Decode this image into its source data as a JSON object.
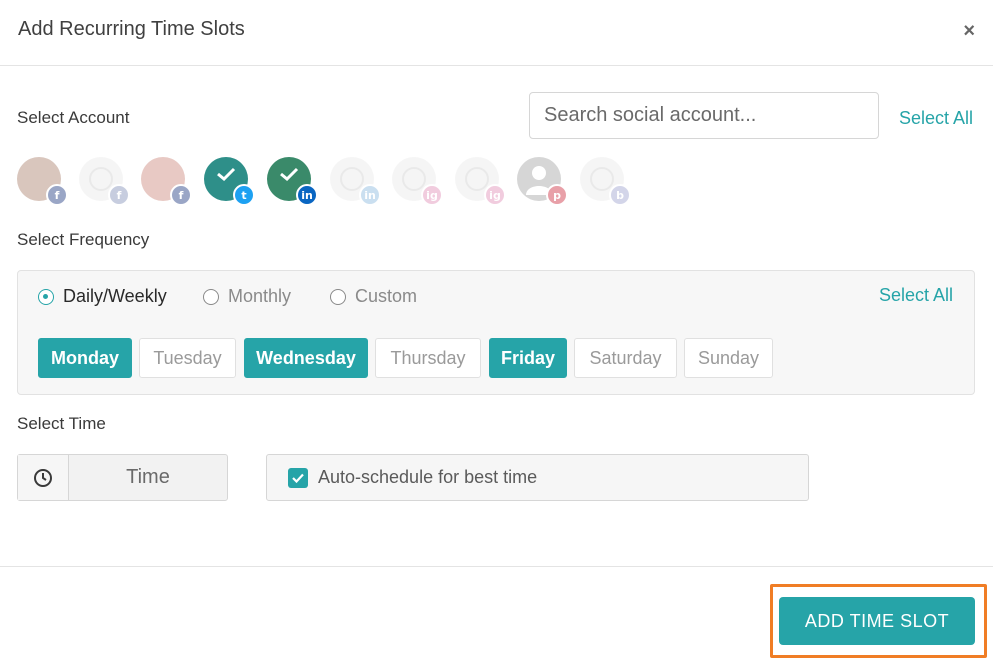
{
  "dialog": {
    "title": "Add Recurring Time Slots",
    "close_glyph": "×"
  },
  "account": {
    "label": "Select Account",
    "search_placeholder": "Search social account...",
    "select_all": "Select All",
    "items": [
      {
        "platform": "facebook",
        "badge": "f",
        "badge_color": "#9aa6c6",
        "selected": false,
        "enabled": true,
        "avatar_color": "#d9c6bd"
      },
      {
        "platform": "facebook",
        "badge": "f",
        "badge_color": "#9aa6c6",
        "selected": false,
        "enabled": false,
        "avatar_color": "#eeeeee"
      },
      {
        "platform": "facebook",
        "badge": "f",
        "badge_color": "#9aa6c6",
        "selected": false,
        "enabled": true,
        "avatar_color": "#e8c9c4"
      },
      {
        "platform": "twitter",
        "badge": "t",
        "badge_color": "#1da1f2",
        "selected": true,
        "enabled": true,
        "avatar_color": "#2e8f89"
      },
      {
        "platform": "linkedin",
        "badge": "in",
        "badge_color": "#0a66c2",
        "selected": true,
        "enabled": true,
        "avatar_color": "#3a8a6a"
      },
      {
        "platform": "linkedin",
        "badge": "in",
        "badge_color": "#9fc6e4",
        "selected": false,
        "enabled": false,
        "avatar_color": "#eeeeee"
      },
      {
        "platform": "instagram",
        "badge": "ig",
        "badge_color": "#e6a3c4",
        "selected": false,
        "enabled": false,
        "avatar_color": "#eeeeee"
      },
      {
        "platform": "instagram",
        "badge": "ig",
        "badge_color": "#e6a3c4",
        "selected": false,
        "enabled": false,
        "avatar_color": "#eeeeee"
      },
      {
        "platform": "pinterest",
        "badge": "p",
        "badge_color": "#e8a0a8",
        "selected": false,
        "enabled": true,
        "avatar_color": "#d6d6d6"
      },
      {
        "platform": "business",
        "badge": "b",
        "badge_color": "#b0b4d8",
        "selected": false,
        "enabled": false,
        "avatar_color": "#eeeeee"
      }
    ]
  },
  "frequency": {
    "label": "Select Frequency",
    "select_all": "Select All",
    "options": [
      {
        "label": "Daily/Weekly",
        "selected": true
      },
      {
        "label": "Monthly",
        "selected": false
      },
      {
        "label": "Custom",
        "selected": false
      }
    ],
    "days": [
      {
        "label": "Monday",
        "selected": true
      },
      {
        "label": "Tuesday",
        "selected": false
      },
      {
        "label": "Wednesday",
        "selected": true
      },
      {
        "label": "Thursday",
        "selected": false
      },
      {
        "label": "Friday",
        "selected": true
      },
      {
        "label": "Saturday",
        "selected": false
      },
      {
        "label": "Sunday",
        "selected": false
      }
    ]
  },
  "time": {
    "label": "Select Time",
    "placeholder": "Time",
    "auto_schedule_label": "Auto-schedule for best time",
    "auto_schedule_checked": true
  },
  "footer": {
    "add_button": "ADD TIME SLOT"
  },
  "colors": {
    "accent": "#26a4a8",
    "highlight": "#f07d25"
  }
}
